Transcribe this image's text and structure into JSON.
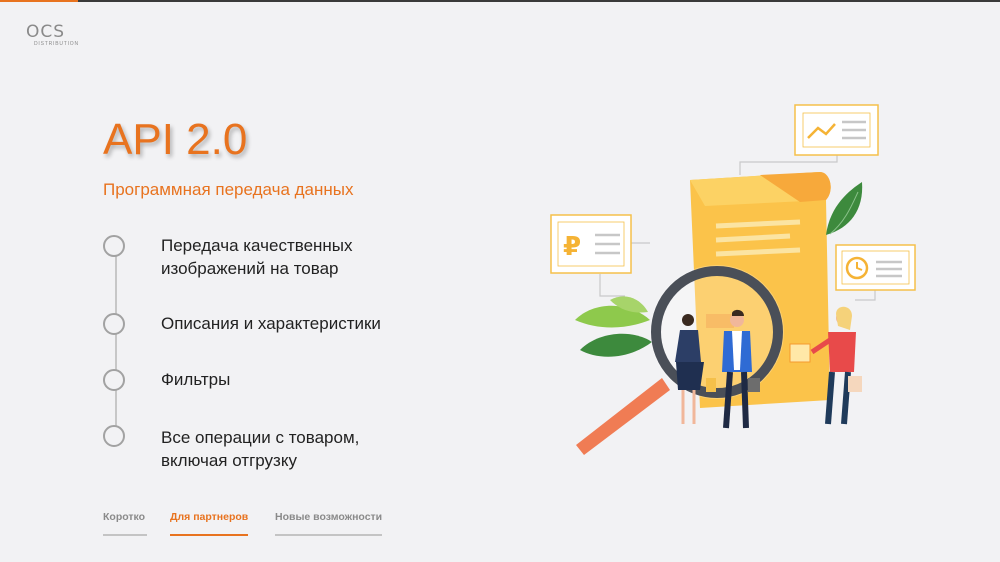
{
  "brand": {
    "name": "OCS",
    "tagline": "DISTRIBUTION"
  },
  "slide": {
    "title": "API 2.0",
    "subtitle": "Программная передача данных",
    "items": [
      {
        "label": "Передача качественных\nизображений на товар"
      },
      {
        "label": "Описания и характеристики"
      },
      {
        "label": "Фильтры"
      },
      {
        "label": "Все операции с товаром,\nвключая отгрузку"
      }
    ]
  },
  "tabs": [
    {
      "label": "Коротко",
      "active": false
    },
    {
      "label": "Для партнеров",
      "active": true
    },
    {
      "label": "Новые возможности",
      "active": false
    }
  ],
  "illustration": {
    "currency_symbol": "₽"
  },
  "colors": {
    "accent": "#e8731f",
    "background": "#f2f2f4",
    "text": "#222222",
    "muted": "#8a8a8a"
  }
}
